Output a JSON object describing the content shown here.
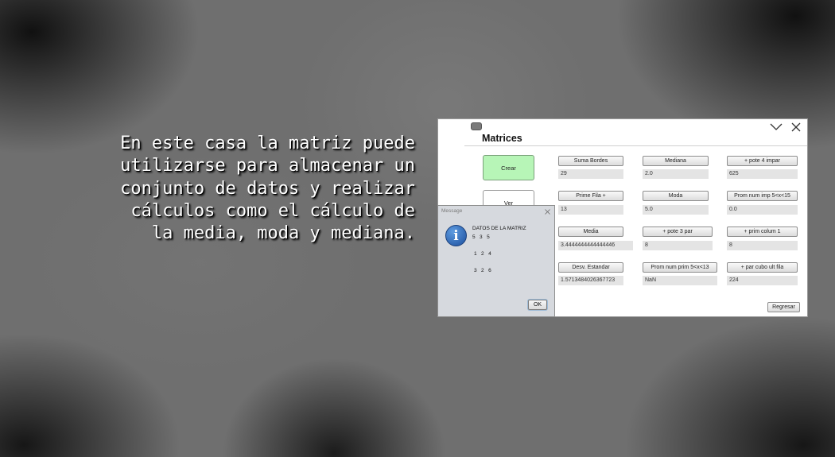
{
  "caption_lines": [
    "En este casa la matriz puede",
    "utilizarse para almacenar un",
    "conjunto de datos y realizar",
    "cálculos como el cálculo de",
    "la media, moda y mediana."
  ],
  "window": {
    "title": "Matrices",
    "crear_label": "Crear",
    "ver_label": "Ver",
    "regresar_label": "Regresar"
  },
  "operations": [
    {
      "label": "Suma Bordes",
      "value": "29"
    },
    {
      "label": "Mediana",
      "value": "2.0"
    },
    {
      "label": "+ pote 4 impar",
      "value": "625"
    },
    {
      "label": "Prime Fila +",
      "value": "13"
    },
    {
      "label": "Moda",
      "value": "5.0"
    },
    {
      "label": "Prom num imp 5<x<15",
      "value": "0.0"
    },
    {
      "label": "Media",
      "value": "3.4444444444444446"
    },
    {
      "label": "+ pote 3 par",
      "value": "8"
    },
    {
      "label": "+ prim colum 1",
      "value": "8"
    },
    {
      "label": "Desv. Estandar",
      "value": "1.5713484026367723"
    },
    {
      "label": "Prom num prim 5<x<13",
      "value": "NaN"
    },
    {
      "label": "+ par cubo  ult fila",
      "value": "224"
    }
  ],
  "dialog": {
    "title": "Message",
    "header": "DATOS DE LA MATRIZ",
    "rows": [
      "5   3   5",
      "1   2   4",
      "3   2   6"
    ],
    "ok_label": "OK"
  },
  "icons": {
    "app": "app-icon",
    "minimize": "chevron-down-icon",
    "close": "close-icon",
    "info": "info-icon"
  },
  "colors": {
    "crear_button": "#b7f5b7",
    "field_bg": "#e4e4e4",
    "dialog_bg": "#d6d9de",
    "info_icon": "#2a64b8"
  }
}
